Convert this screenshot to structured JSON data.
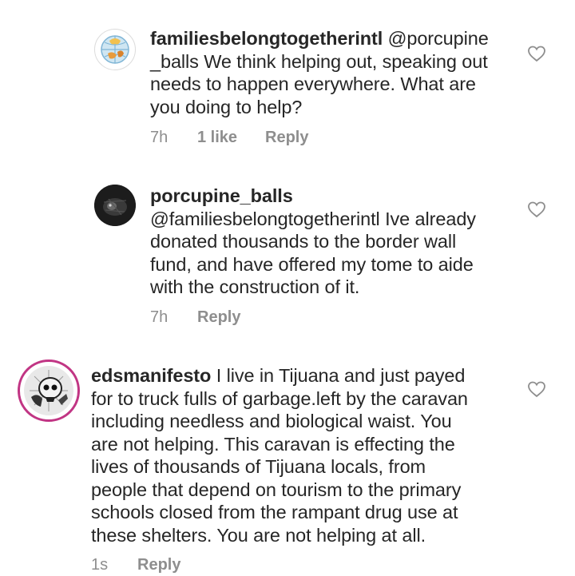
{
  "comments": [
    {
      "username": "familiesbelongtogetherintl",
      "text_lines": [
        " @porcupine",
        "_balls We think helping out, speaking out",
        "needs to happen everywhere. What are",
        "you doing to help?"
      ],
      "time": "7h",
      "likes": "1 like",
      "reply": "Reply",
      "avatar": "globe-hands-icon"
    },
    {
      "username": "porcupine_balls",
      "text_lines": [
        "",
        "@familiesbelongtogetherintl Ive already",
        "donated thousands to the border wall",
        "fund, and have offered my tome to aide",
        "with the construction of it."
      ],
      "time": "7h",
      "reply": "Reply",
      "avatar": "dark-animal-icon"
    },
    {
      "username": "edsmanifesto",
      "text_lines": [
        " I live in Tijuana and just payed",
        "for to truck fulls of garbage.left by the caravan",
        "including  needless and biological waist. You",
        "are not helping. This caravan is effecting the",
        "lives of thousands of Tijuana locals, from",
        "people that depend on tourism to the primary",
        "schools closed from the rampant drug use at",
        "these shelters. You are not helping at all."
      ],
      "time": "1s",
      "reply": "Reply",
      "avatar": "skull-icon"
    }
  ],
  "colors": {
    "text": "#262626",
    "meta": "#8e8e8e",
    "story_ring": "#c13584"
  }
}
